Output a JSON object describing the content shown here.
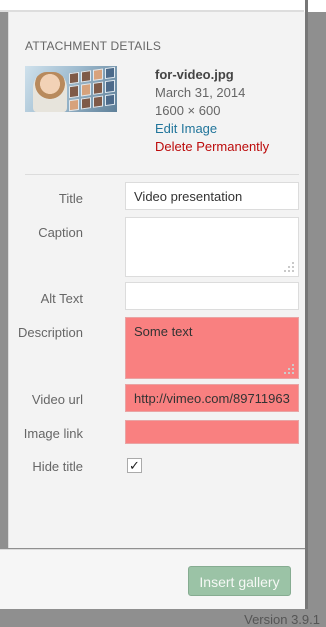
{
  "attachment": {
    "heading": "Attachment Details",
    "filename": "for-video.jpg",
    "date": "March 31, 2014",
    "dimensions": "1600 × 600",
    "edit_link": "Edit Image",
    "delete_link": "Delete Permanently"
  },
  "fields": {
    "title": {
      "label": "Title",
      "value": "Video presentation"
    },
    "caption": {
      "label": "Caption",
      "value": ""
    },
    "alt_text": {
      "label": "Alt Text",
      "value": ""
    },
    "description": {
      "label": "Description",
      "value": "Some text"
    },
    "video_url": {
      "label": "Video url",
      "value": "http://vimeo.com/89711963"
    },
    "image_link": {
      "label": "Image link",
      "value": ""
    },
    "hide_title": {
      "label": "Hide title",
      "checked": true,
      "mark": "✓"
    }
  },
  "toolbar": {
    "insert_button": "Insert gallery"
  },
  "footer": {
    "version": "Version 3.9.1"
  },
  "colors": {
    "highlight": "#f98080",
    "link_blue": "#21759b",
    "delete_red": "#bc0b0b",
    "button_green": "#9bc3a6"
  }
}
